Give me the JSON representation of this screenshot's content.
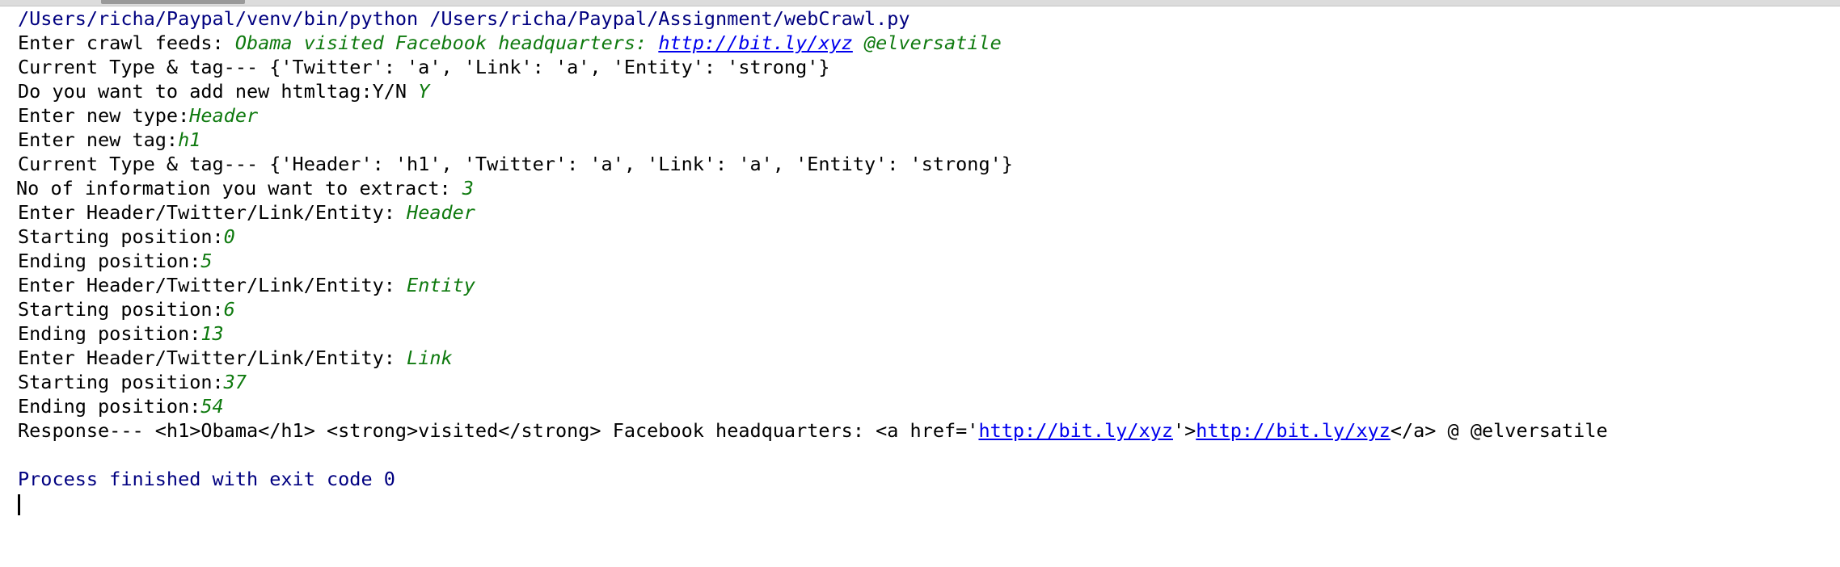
{
  "run_command": "/Users/richa/Paypal/venv/bin/python /Users/richa/Paypal/Assignment/webCrawl.py",
  "crawl_feed": {
    "prompt": "Enter crawl feeds: ",
    "input_text": "Obama visited Facebook headquarters: ",
    "input_link": "http://bit.ly/xyz",
    "input_suffix": " @elversatile"
  },
  "current_tags_1": "Current Type & tag--- {'Twitter': 'a', 'Link': 'a', 'Entity': 'strong'}",
  "add_tag": {
    "prompt": "Do you want to add new htmltag:Y/N ",
    "value": "Y"
  },
  "new_type": {
    "prompt": "Enter new type:",
    "value": "Header"
  },
  "new_tag": {
    "prompt": "Enter new tag:",
    "value": "h1"
  },
  "current_tags_2": "Current Type & tag--- {'Header': 'h1', 'Twitter': 'a', 'Link': 'a', 'Entity': 'strong'}",
  "info_count": {
    "prompt": "No of information you want to extract: ",
    "value": "3"
  },
  "extractions": [
    {
      "type_prompt": "Enter Header/Twitter/Link/Entity: ",
      "type_value": "Header",
      "start_prompt": "Starting position:",
      "start_value": "0",
      "end_prompt": "Ending position:",
      "end_value": "5"
    },
    {
      "type_prompt": "Enter Header/Twitter/Link/Entity: ",
      "type_value": "Entity",
      "start_prompt": "Starting position:",
      "start_value": "6",
      "end_prompt": "Ending position:",
      "end_value": "13"
    },
    {
      "type_prompt": "Enter Header/Twitter/Link/Entity: ",
      "type_value": "Link",
      "start_prompt": "Starting position:",
      "start_value": "37",
      "end_prompt": "Ending position:",
      "end_value": "54"
    }
  ],
  "response": {
    "prefix": "Response--- <h1>Obama</h1> <strong>visited</strong> Facebook headquarters: <a href='",
    "href_link": "http://bit.ly/xyz",
    "middle": "'>",
    "anchor_link": "http://bit.ly/xyz",
    "suffix": "</a> @ @elversatile"
  },
  "exit_message": "Process finished with exit code 0",
  "colors": {
    "system_text": "#000080",
    "user_input": "#0f7a0f",
    "link": "#0000ee",
    "output_text": "#000000"
  }
}
